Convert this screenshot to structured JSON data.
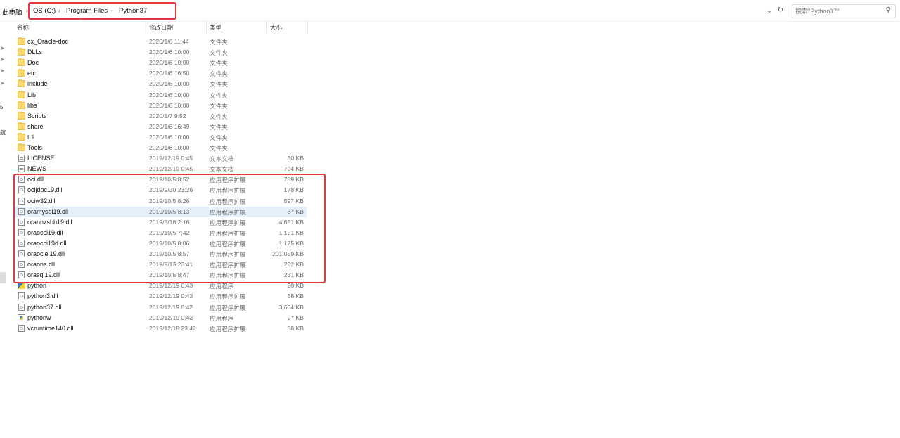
{
  "breadcrumb": {
    "root": "此电脑",
    "segments": [
      "OS (C:)",
      "Program Files",
      "Python37"
    ],
    "separator": "›"
  },
  "search": {
    "placeholder": "搜索\"Python37\""
  },
  "nav_fragments": [
    "5",
    "航"
  ],
  "columns": {
    "name": "名称",
    "date": "修改日期",
    "type": "类型",
    "size": "大小"
  },
  "files": [
    {
      "name": "cx_Oracle-doc",
      "date": "2020/1/6 11:44",
      "type": "文件夹",
      "size": "",
      "icon": "folder-icon"
    },
    {
      "name": "DLLs",
      "date": "2020/1/6 10:00",
      "type": "文件夹",
      "size": "",
      "icon": "folder-icon"
    },
    {
      "name": "Doc",
      "date": "2020/1/6 10:00",
      "type": "文件夹",
      "size": "",
      "icon": "folder-icon"
    },
    {
      "name": "etc",
      "date": "2020/1/6 16:50",
      "type": "文件夹",
      "size": "",
      "icon": "folder-icon"
    },
    {
      "name": "include",
      "date": "2020/1/6 10:00",
      "type": "文件夹",
      "size": "",
      "icon": "folder-icon"
    },
    {
      "name": "Lib",
      "date": "2020/1/6 10:00",
      "type": "文件夹",
      "size": "",
      "icon": "folder-icon"
    },
    {
      "name": "libs",
      "date": "2020/1/6 10:00",
      "type": "文件夹",
      "size": "",
      "icon": "folder-icon"
    },
    {
      "name": "Scripts",
      "date": "2020/1/7 9:52",
      "type": "文件夹",
      "size": "",
      "icon": "folder-icon"
    },
    {
      "name": "share",
      "date": "2020/1/6 16:49",
      "type": "文件夹",
      "size": "",
      "icon": "folder-icon"
    },
    {
      "name": "tcl",
      "date": "2020/1/6 10:00",
      "type": "文件夹",
      "size": "",
      "icon": "folder-icon"
    },
    {
      "name": "Tools",
      "date": "2020/1/6 10:00",
      "type": "文件夹",
      "size": "",
      "icon": "folder-icon"
    },
    {
      "name": "LICENSE",
      "date": "2019/12/19 0:45",
      "type": "文本文档",
      "size": "30 KB",
      "icon": "document-icon"
    },
    {
      "name": "NEWS",
      "date": "2019/12/19 0:45",
      "type": "文本文档",
      "size": "704 KB",
      "icon": "document-icon"
    },
    {
      "name": "oci.dll",
      "date": "2019/10/5 8:52",
      "type": "应用程序扩展",
      "size": "789 KB",
      "icon": "dll-icon"
    },
    {
      "name": "ocijdbc19.dll",
      "date": "2019/9/30 23:26",
      "type": "应用程序扩展",
      "size": "178 KB",
      "icon": "dll-icon"
    },
    {
      "name": "ociw32.dll",
      "date": "2019/10/5 8:28",
      "type": "应用程序扩展",
      "size": "597 KB",
      "icon": "dll-icon"
    },
    {
      "name": "oramysql19.dll",
      "date": "2019/10/5 8:13",
      "type": "应用程序扩展",
      "size": "87 KB",
      "icon": "dll-icon",
      "selected": true
    },
    {
      "name": "orannzsbb19.dll",
      "date": "2019/5/18 2:16",
      "type": "应用程序扩展",
      "size": "4,651 KB",
      "icon": "dll-icon"
    },
    {
      "name": "oraocci19.dll",
      "date": "2019/10/5 7:42",
      "type": "应用程序扩展",
      "size": "1,151 KB",
      "icon": "dll-icon"
    },
    {
      "name": "oraocci19d.dll",
      "date": "2019/10/5 8:06",
      "type": "应用程序扩展",
      "size": "1,175 KB",
      "icon": "dll-icon"
    },
    {
      "name": "oraociei19.dll",
      "date": "2019/10/5 8:57",
      "type": "应用程序扩展",
      "size": "201,059 KB",
      "icon": "dll-icon"
    },
    {
      "name": "oraons.dll",
      "date": "2019/9/13 23:41",
      "type": "应用程序扩展",
      "size": "282 KB",
      "icon": "dll-icon"
    },
    {
      "name": "orasql19.dll",
      "date": "2019/10/5 8:47",
      "type": "应用程序扩展",
      "size": "231 KB",
      "icon": "dll-icon"
    },
    {
      "name": "python",
      "date": "2019/12/19 0:43",
      "type": "应用程序",
      "size": "98 KB",
      "icon": "python-app-icon"
    },
    {
      "name": "python3.dll",
      "date": "2019/12/19 0:43",
      "type": "应用程序扩展",
      "size": "58 KB",
      "icon": "dll-icon"
    },
    {
      "name": "python37.dll",
      "date": "2019/12/19 0:42",
      "type": "应用程序扩展",
      "size": "3,664 KB",
      "icon": "dll-icon"
    },
    {
      "name": "pythonw",
      "date": "2019/12/19 0:43",
      "type": "应用程序",
      "size": "97 KB",
      "icon": "pythonw-app-icon"
    },
    {
      "name": "vcruntime140.dll",
      "date": "2019/12/18 23:42",
      "type": "应用程序扩展",
      "size": "88 KB",
      "icon": "dll-icon"
    }
  ],
  "colors": {
    "highlight": "#e0393e",
    "selected_row": "#e6f0fa",
    "folder": "#f7d774"
  }
}
